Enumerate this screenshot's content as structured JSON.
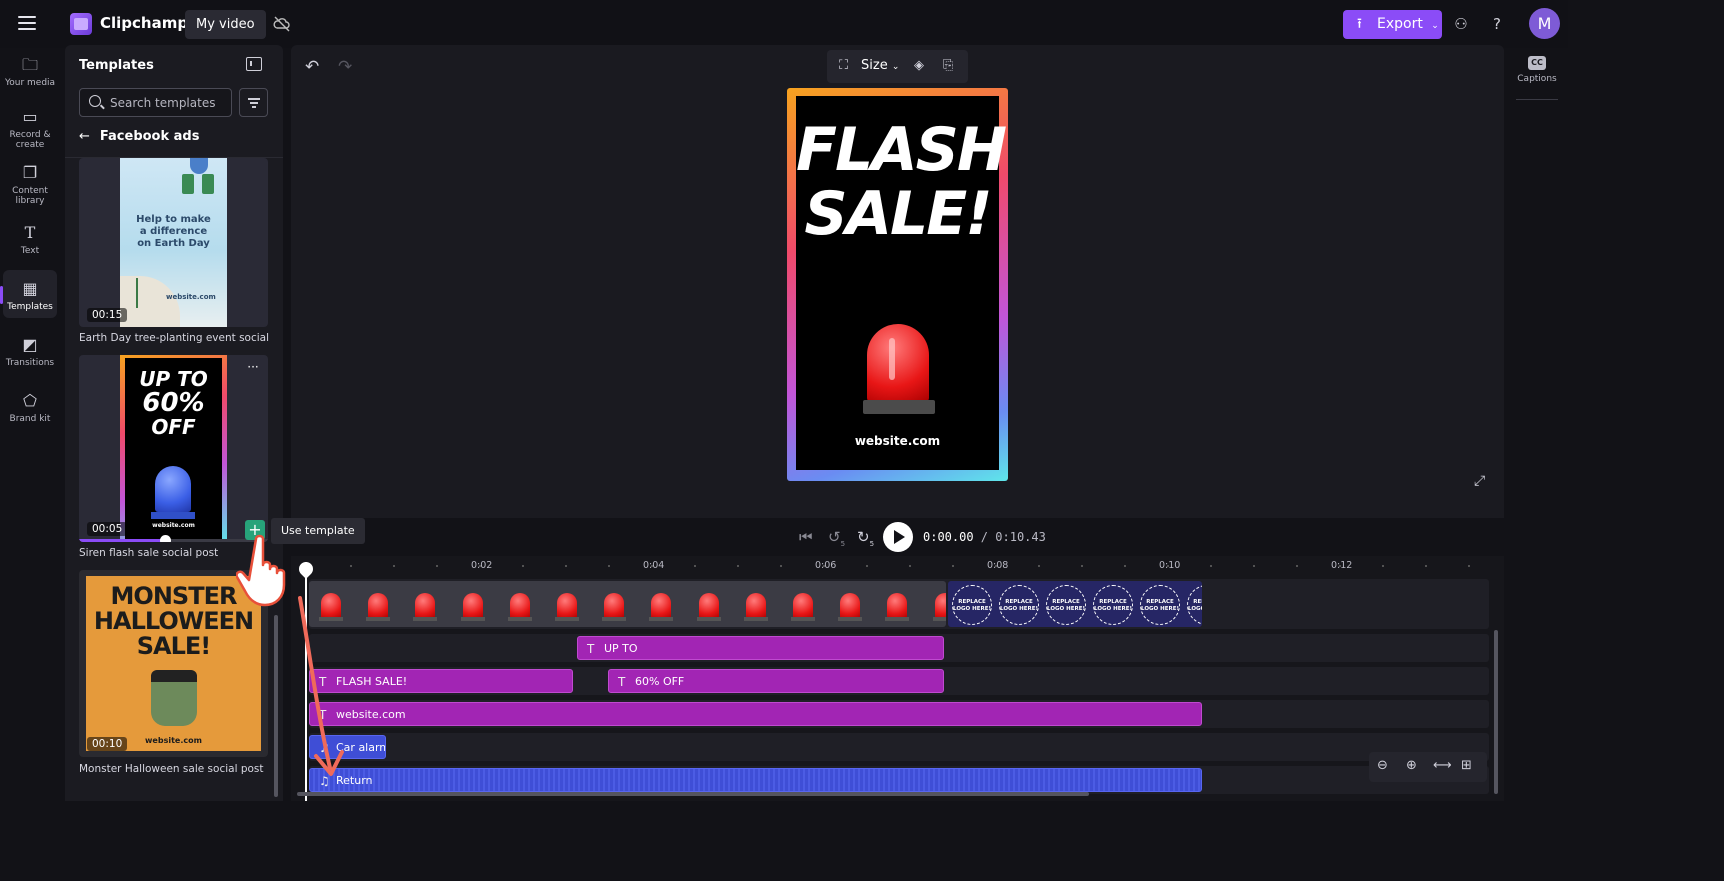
{
  "app": {
    "name": "Clipchamp",
    "project_name": "My video",
    "export_label": "Export",
    "avatar_letter": "M"
  },
  "rail": {
    "items": [
      {
        "label": "Your media",
        "icon": "folder-icon"
      },
      {
        "label": "Record & create",
        "icon": "camera-icon"
      },
      {
        "label": "Content library",
        "icon": "library-icon"
      },
      {
        "label": "Text",
        "icon": "text-icon"
      },
      {
        "label": "Templates",
        "icon": "templates-icon",
        "active": true
      },
      {
        "label": "Transitions",
        "icon": "transitions-icon"
      },
      {
        "label": "Brand kit",
        "icon": "brand-kit-icon"
      }
    ]
  },
  "panel": {
    "title": "Templates",
    "search_placeholder": "Search templates",
    "back_label": "Facebook ads",
    "templates": [
      {
        "caption": "Earth Day tree-planting event social p...",
        "duration": "00:15",
        "line1": "Help to make",
        "line2": "a difference",
        "line3": "on Earth Day",
        "site": "website.com"
      },
      {
        "caption": "Siren flash sale social post",
        "duration": "00:05",
        "line1": "UP TO",
        "line2": "60%",
        "line3": "OFF",
        "site": "website.com"
      },
      {
        "caption": "Monster Halloween sale social post",
        "duration": "00:10",
        "line1": "MONSTER",
        "line2": "HALLOWEEN",
        "line3": "SALE!",
        "site": "website.com"
      }
    ],
    "more_label": "···"
  },
  "tooltip": {
    "label": "Use template"
  },
  "preview": {
    "size_label": "Size",
    "canvas": {
      "headline_1": "FLASH",
      "headline_2": "SALE!",
      "site": "website.com"
    }
  },
  "captions": {
    "label": "Captions",
    "badge": "CC"
  },
  "playback": {
    "current": "0:00.00",
    "separator": " / ",
    "total": "0:10.43",
    "skip_back": "5",
    "skip_fwd": "5"
  },
  "timeline": {
    "ruler": [
      "0:02",
      "0:04",
      "0:06",
      "0:08",
      "0:10",
      "0:12"
    ],
    "logo_placeholder": "REPLACE LOGO HERE!",
    "clips": {
      "up_to": "UP TO",
      "flash_sale": "FLASH SALE!",
      "sixty_off": "60% OFF",
      "website": "website.com",
      "car_alarm": "Car alarm",
      "return": "Return"
    }
  },
  "colors": {
    "accent": "#8b4cf7",
    "text_clip": "#a225b4",
    "audio_clip": "#3f4ed6",
    "add_button": "#27a37a"
  }
}
